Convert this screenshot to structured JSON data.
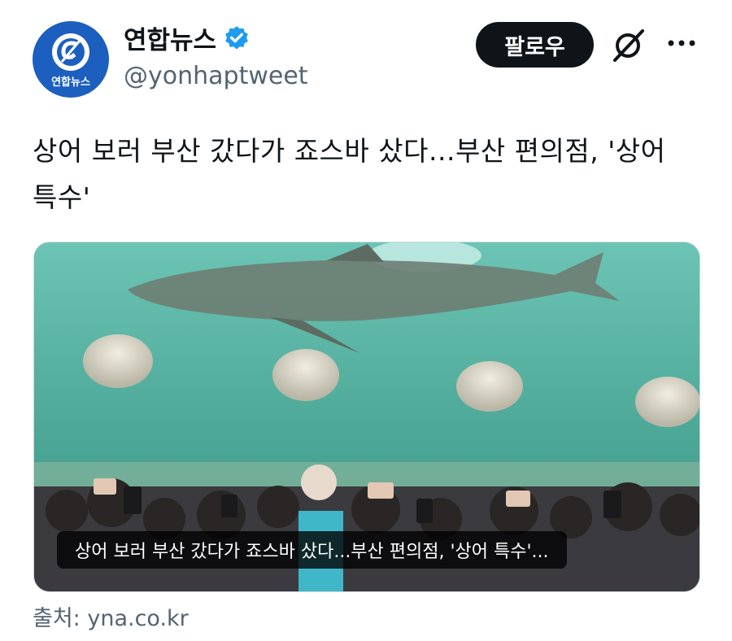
{
  "account": {
    "avatar_label": "연합뉴스",
    "name": "연합뉴스",
    "handle": "@yonhaptweet",
    "verified_color": "#1d9bf0"
  },
  "actions": {
    "follow_label": "팔로우",
    "grok_icon": "grok-icon",
    "more_icon": "more-icon"
  },
  "tweet": {
    "text": "상어 보러 부산 갔다가 죠스바 샀다...부산 편의점, '상어 특수'"
  },
  "card": {
    "image_alt": "shark in aquarium with crowd",
    "caption": "상어 보러 부산 갔다가 죠스바 샀다...부산 편의점, '상어 특수'...",
    "source": "출처: yna.co.kr"
  },
  "colors": {
    "follow_bg": "#0f1419",
    "text_secondary": "#536471",
    "water": "#57b6a7"
  }
}
